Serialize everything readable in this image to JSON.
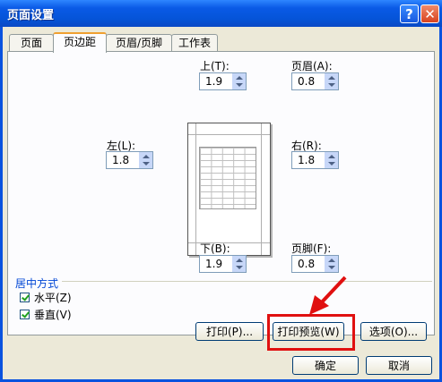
{
  "window": {
    "title": "页面设置",
    "help_symbol": "?",
    "close_symbol": "✕"
  },
  "tabs": [
    {
      "label": "页面"
    },
    {
      "label": "页边距",
      "active": true
    },
    {
      "label": "页眉/页脚"
    },
    {
      "label": "工作表"
    }
  ],
  "margins": {
    "top": {
      "label": "上(T):",
      "value": "1.9"
    },
    "header": {
      "label": "页眉(A):",
      "value": "0.8"
    },
    "left": {
      "label": "左(L):",
      "value": "1.8"
    },
    "right": {
      "label": "右(R):",
      "value": "1.8"
    },
    "bottom": {
      "label": "下(B):",
      "value": "1.9"
    },
    "footer": {
      "label": "页脚(F):",
      "value": "0.8"
    }
  },
  "center": {
    "heading": "居中方式",
    "horizontal": {
      "label": "水平(Z)",
      "checked": true
    },
    "vertical": {
      "label": "垂直(V)",
      "checked": true
    }
  },
  "buttons": {
    "print": "打印(P)...",
    "preview": "打印预览(W)",
    "options": "选项(O)...",
    "ok": "确定",
    "cancel": "取消"
  },
  "colors": {
    "title_bar": "#0a5ae6",
    "dialog_bg": "#ece9d8",
    "highlight": "#e01010"
  },
  "annotation": {
    "arrow_color": "#e01010",
    "target": "preview-button"
  }
}
